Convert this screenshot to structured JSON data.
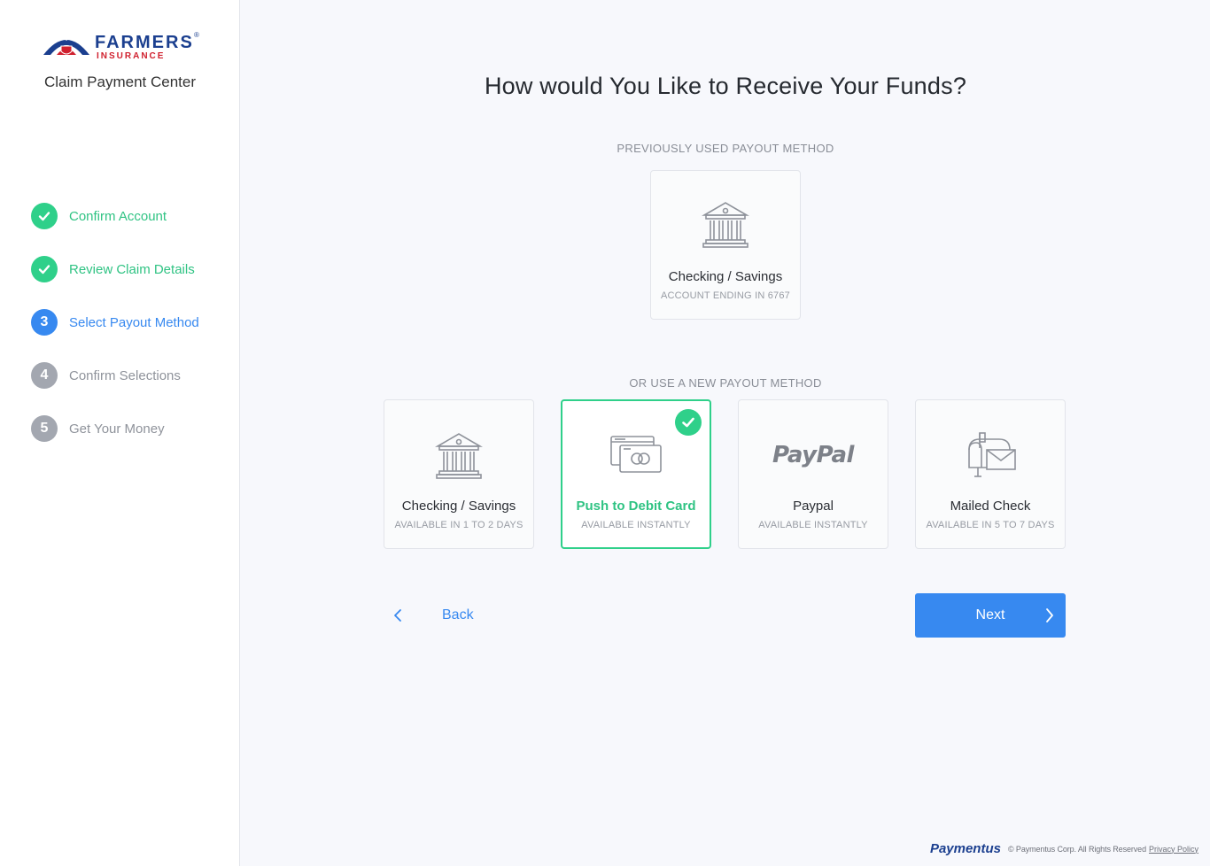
{
  "brand": {
    "logo_word": "FARMERS",
    "logo_sub": "INSURANCE",
    "logo_reg": "®",
    "center_title": "Claim Payment Center"
  },
  "steps": [
    {
      "label": "Confirm Account",
      "state": "done",
      "marker": "✓"
    },
    {
      "label": "Review Claim Details",
      "state": "done",
      "marker": "✓"
    },
    {
      "label": "Select Payout Method",
      "state": "active",
      "marker": "3"
    },
    {
      "label": "Confirm Selections",
      "state": "todo",
      "marker": "4"
    },
    {
      "label": "Get Your Money",
      "state": "todo",
      "marker": "5"
    }
  ],
  "main": {
    "heading": "How would You Like to Receive Your Funds?",
    "previous_label": "PREVIOUSLY USED PAYOUT METHOD",
    "previous_card": {
      "title": "Checking / Savings",
      "sub": "ACCOUNT ENDING IN 6767",
      "icon": "bank-icon"
    },
    "new_label": "OR USE A NEW PAYOUT METHOD",
    "options": [
      {
        "title": "Checking / Savings",
        "sub": "AVAILABLE IN 1 TO 2 DAYS",
        "icon": "bank-icon",
        "selected": false
      },
      {
        "title": "Push to Debit Card",
        "sub": "AVAILABLE INSTANTLY",
        "icon": "debit-card-icon",
        "selected": true
      },
      {
        "title": "Paypal",
        "sub": "AVAILABLE INSTANTLY",
        "icon": "paypal-logo",
        "logo_text": "PayPal",
        "selected": false
      },
      {
        "title": "Mailed Check",
        "sub": "AVAILABLE IN 5 TO 7 DAYS",
        "icon": "mailbox-icon",
        "selected": false
      }
    ],
    "back_label": "Back",
    "next_label": "Next"
  },
  "footer": {
    "brand": "Paymentus",
    "copyright": "© Paymentus Corp. All Rights Reserved",
    "privacy": "Privacy Policy"
  },
  "colors": {
    "accent_blue": "#3789f0",
    "success_green": "#2fd08a",
    "muted_gray": "#a3a7b0",
    "brand_navy": "#1b3f8f",
    "brand_red": "#d0202e"
  }
}
